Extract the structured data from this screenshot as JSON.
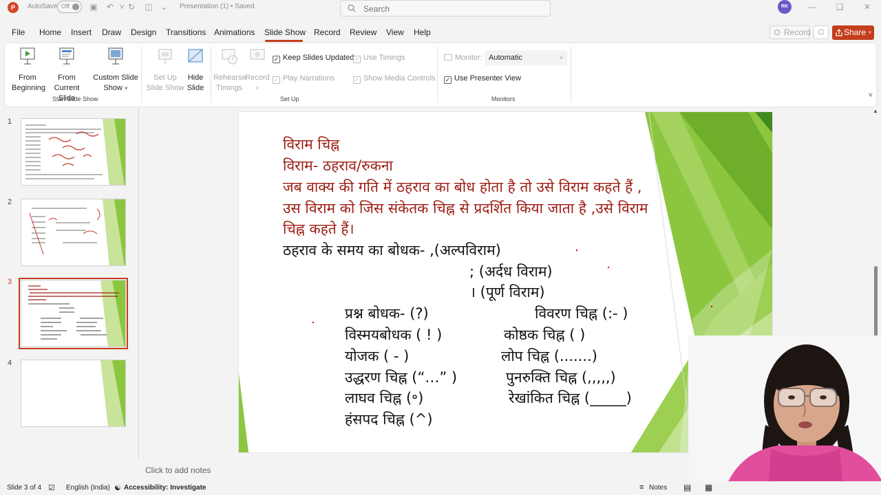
{
  "titlebar": {
    "autosave_label": "AutoSave",
    "autosave_state": "Off",
    "doc_title": "Presentation (1) • Saved",
    "search_placeholder": "Search",
    "user_initials": "RK"
  },
  "tabs": [
    "File",
    "Home",
    "Insert",
    "Draw",
    "Design",
    "Transitions",
    "Animations",
    "Slide Show",
    "Record",
    "Review",
    "View",
    "Help"
  ],
  "active_tab": "Slide Show",
  "top_actions": {
    "record_label": "Record",
    "share_label": "Share"
  },
  "ribbon": {
    "from_beginning": [
      "From",
      "Beginning"
    ],
    "from_current": [
      "From",
      "Current Slide"
    ],
    "custom_show": [
      "Custom Slide",
      "Show"
    ],
    "group_start": "Start Slide Show",
    "setup_show": [
      "Set Up",
      "Slide Show"
    ],
    "hide_slide": [
      "Hide",
      "Slide"
    ],
    "rehearse": [
      "Rehearse",
      "Timings"
    ],
    "record": "Record",
    "keep_updated": "Keep Slides Updated",
    "use_timings": "Use Timings",
    "play_narrations": "Play Narrations",
    "show_media": "Show Media Controls",
    "group_setup": "Set Up",
    "monitor_label": "Monitor:",
    "monitor_value": "Automatic",
    "presenter_view": "Use Presenter View",
    "group_monitors": "Monitors"
  },
  "thumbnails": [
    {
      "num": "1"
    },
    {
      "num": "2"
    },
    {
      "num": "3",
      "selected": true
    },
    {
      "num": "4"
    }
  ],
  "slide": {
    "title1": "विराम चिह्न",
    "title2": "विराम- ठहराव/रुकना",
    "def1": " जब वाक्य की गति में ठहराव का बोध होता है तो उसे विराम कहते हैं ,",
    "def2": "उस विराम को जिस संकेतक चिह्न से प्रदर्शित किया जाता है ,उसे विराम",
    "def3": "चिह्न कहते हैं।",
    "pause_line": "ठहराव के समय का बोधक- ,(अल्पविराम)",
    "semi": "; (अर्दध विराम)",
    "full": "। (पूर्ण विराम)",
    "left_items": [
      "प्रश्न बोधक- (?)",
      "विस्मयबोधक ( ! )",
      "योजक   ( - )",
      "उद्धरण चिह्न (“…” )",
      "लाघव चिह्न (॰)",
      "हंसपद चिह्न (^)"
    ],
    "right_items": [
      "विवरण चिह्न (:- )",
      "कोष्ठक चिह्न ( )",
      "लोप चिह्न (.......)",
      "पुनरुक्ति चिह्न (,,,,,)",
      "रेखांकित चिह्न (_____)"
    ]
  },
  "notes_placeholder": "Click to add notes",
  "status": {
    "slide_of": "Slide 3 of 4",
    "language": "English (India)",
    "accessibility": "Accessibility: Investigate",
    "notes": "Notes"
  },
  "colors": {
    "accent": "#c43e1c",
    "slide_green": "#8cc63f",
    "hindi_red": "#9b1c12"
  }
}
